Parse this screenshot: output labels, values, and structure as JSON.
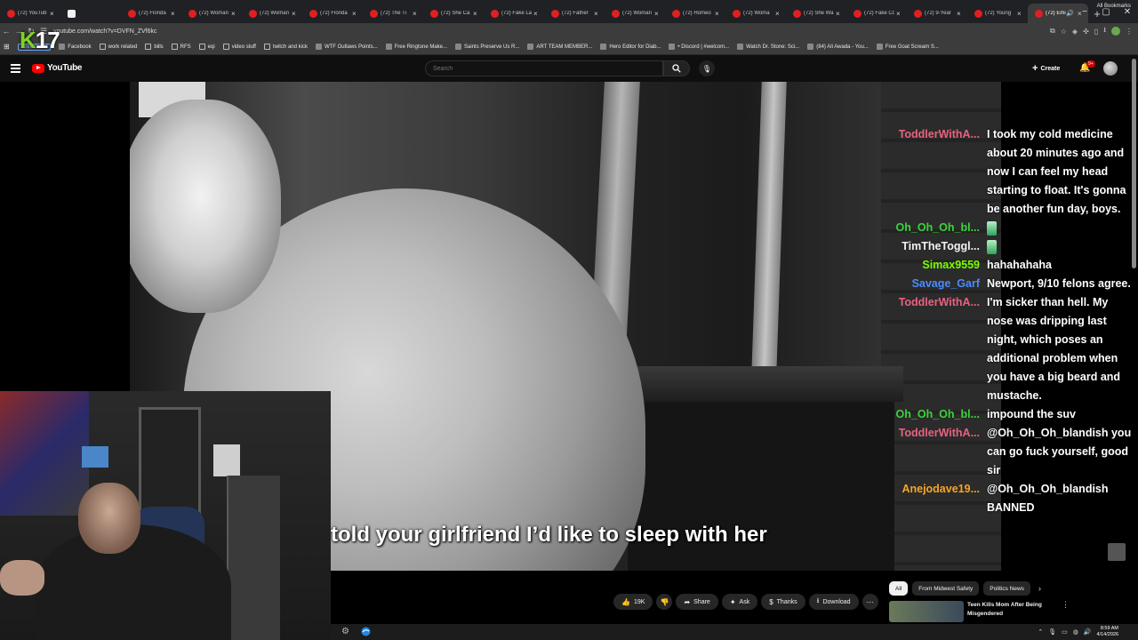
{
  "browser": {
    "tabs": [
      {
        "label": "(72) YouTub"
      },
      {
        "label": ""
      },
      {
        "label": "(72) Florida"
      },
      {
        "label": "(72) Woman"
      },
      {
        "label": "(72) Woman"
      },
      {
        "label": "(72) Florida"
      },
      {
        "label": "(72) The Ti"
      },
      {
        "label": "(72) She Ca"
      },
      {
        "label": "(72) Fake La"
      },
      {
        "label": "(72) Father"
      },
      {
        "label": "(72) Woman"
      },
      {
        "label": "(72) Homeo"
      },
      {
        "label": "(72) Woma"
      },
      {
        "label": "(72) She Wa"
      },
      {
        "label": "(72) Fake Co"
      },
      {
        "label": "(72) 9-Year"
      },
      {
        "label": "(72) Young"
      },
      {
        "label": "(72) Emi"
      }
    ],
    "url": "youtube.com/watch?v=DVFN_ZVf6kc",
    "bookmarks": [
      {
        "label": "streamstuff",
        "kind": "tag"
      },
      {
        "label": "Facebook",
        "kind": "site"
      },
      {
        "label": "work related",
        "kind": "folder"
      },
      {
        "label": "bills",
        "kind": "folder"
      },
      {
        "label": "RFS",
        "kind": "folder"
      },
      {
        "label": "eqi",
        "kind": "folder"
      },
      {
        "label": "video stuff",
        "kind": "folder"
      },
      {
        "label": "twitch and kick",
        "kind": "folder"
      },
      {
        "label": "WTF Outlaws Points...",
        "kind": "site"
      },
      {
        "label": "Free Ringtone Make...",
        "kind": "site"
      },
      {
        "label": "Saints Preserve Us R...",
        "kind": "site"
      },
      {
        "label": "ART TEAM MEMBER...",
        "kind": "site"
      },
      {
        "label": "Hero Editor for Diab...",
        "kind": "site"
      },
      {
        "label": "• Discord | #welcom...",
        "kind": "site"
      },
      {
        "label": "Watch Dr. Stone: Sci...",
        "kind": "site"
      },
      {
        "label": "(84) Ali Awada - You...",
        "kind": "site"
      },
      {
        "label": "Free Goat Scream S...",
        "kind": "site"
      }
    ],
    "all_bookmarks": "All Bookmarks"
  },
  "overlay": {
    "logo_k": "K",
    "logo_num": "17"
  },
  "youtube": {
    "logo": "YouTube",
    "search_placeholder": "Search",
    "create": "Create",
    "notif_badge": "9+"
  },
  "video": {
    "caption": "told your girlfriend I’d like to sleep with her"
  },
  "chat": [
    {
      "user": "ToddlerWithA...",
      "color": "#e8627f",
      "text": "I took my cold medicine about 20 minutes ago and now I can feel my head starting to float. It's gonna be another fun day, boys."
    },
    {
      "user": "Oh_Oh_Oh_bl...",
      "color": "#3cd33c",
      "text": "",
      "emote": true
    },
    {
      "user": "TimTheToggl...",
      "color": "#f2f2f2",
      "text": "",
      "emote": true
    },
    {
      "user": "Simax9559",
      "color": "#7cfc00",
      "text": "hahahahaha"
    },
    {
      "user": "Savage_Garf",
      "color": "#4a8cff",
      "text": "Newport, 9/10 felons agree."
    },
    {
      "user": "ToddlerWithA...",
      "color": "#e8627f",
      "text": "I'm sicker than hell. My nose was dripping last night, which poses an additional problem when you have a big beard and mustache."
    },
    {
      "user": "Oh_Oh_Oh_bl...",
      "color": "#3cd33c",
      "text": "impound the suv"
    },
    {
      "user": "ToddlerWithA...",
      "color": "#e8627f",
      "text": "@Oh_Oh_Oh_blandish you can go fuck yourself, good sir"
    },
    {
      "user": "Anejodave19...",
      "color": "#f5a623",
      "text": "@Oh_Oh_Oh_blandish BANNED"
    }
  ],
  "actions": {
    "likes": "19K",
    "share": "Share",
    "ask": "Ask",
    "thanks": "Thanks",
    "download": "Download"
  },
  "suggestions": {
    "chips": [
      "All",
      "From Midwest Safety",
      "Politics News"
    ],
    "video_title": "Teen Kills Mom After Being Misgendered"
  },
  "taskbar": {
    "time": "8:59 AM",
    "date": "4/14/2026"
  }
}
